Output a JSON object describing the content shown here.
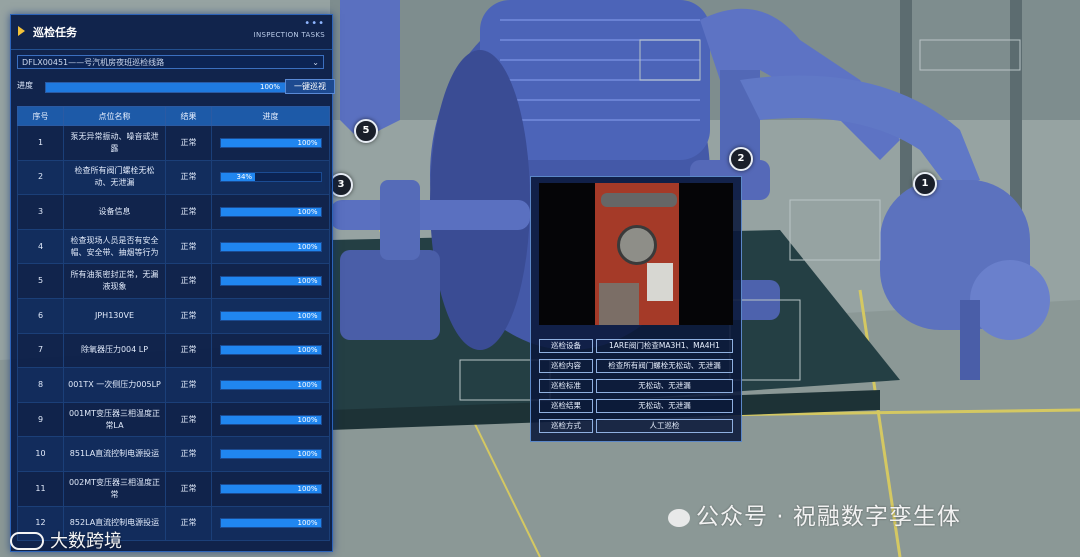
{
  "panel": {
    "title": "巡检任务",
    "subtitle": "INSPECTION TASKS",
    "dots": "•••",
    "route": "DFLX00451——号汽机房夜班巡检线路",
    "progress_label": "进度",
    "progress": 100,
    "progress_text": "100%",
    "oneclick_label": "一键巡视",
    "columns": [
      "序号",
      "点位名称",
      "结果",
      "进度"
    ],
    "rows": [
      {
        "no": "1",
        "name": "泵无异常振动、噪音或泄露",
        "result": "正常",
        "progress": 100,
        "pct": "100%"
      },
      {
        "no": "2",
        "name": "检查所有阀门螺栓无松动、无泄漏",
        "result": "正常",
        "progress": 34,
        "pct": "34%"
      },
      {
        "no": "3",
        "name": "设备信息",
        "result": "正常",
        "progress": 100,
        "pct": "100%"
      },
      {
        "no": "4",
        "name": "检查现场人员是否有安全帽、安全带、抽烟等行为",
        "result": "正常",
        "progress": 100,
        "pct": "100%"
      },
      {
        "no": "5",
        "name": "所有油泵密封正常，无漏液现象",
        "result": "正常",
        "progress": 100,
        "pct": "100%"
      },
      {
        "no": "6",
        "name": "JPH130VE",
        "result": "正常",
        "progress": 100,
        "pct": "100%"
      },
      {
        "no": "7",
        "name": "除氧器压力004 LP",
        "result": "正常",
        "progress": 100,
        "pct": "100%"
      },
      {
        "no": "8",
        "name": "001TX 一次侧压力005LP",
        "result": "正常",
        "progress": 100,
        "pct": "100%"
      },
      {
        "no": "9",
        "name": "001MT变压器三相温度正常LA",
        "result": "正常",
        "progress": 100,
        "pct": "100%"
      },
      {
        "no": "10",
        "name": "851LA直流控制电源投运",
        "result": "正常",
        "progress": 100,
        "pct": "100%"
      },
      {
        "no": "11",
        "name": "002MT变压器三相温度正常",
        "result": "正常",
        "progress": 100,
        "pct": "100%"
      },
      {
        "no": "12",
        "name": "852LA直流控制电源投运",
        "result": "正常",
        "progress": 100,
        "pct": "100%"
      }
    ]
  },
  "markers": [
    "1",
    "2",
    "3",
    "5"
  ],
  "popup": {
    "rows": [
      {
        "label": "巡检设备",
        "value": "1ARE阀门检查MA3H1、MA4H1"
      },
      {
        "label": "巡检内容",
        "value": "检查所有阀门螺栓无松动、无泄漏"
      },
      {
        "label": "巡检标准",
        "value": "无松动、无泄漏"
      },
      {
        "label": "巡检结果",
        "value": "无松动、无泄漏"
      },
      {
        "label": "巡检方式",
        "value": "人工巡检"
      }
    ]
  },
  "watermarks": {
    "right": "公众号 · 祝融数字孪生体",
    "left": "大数跨境"
  },
  "colors": {
    "panel_bg": "#081c46",
    "accent": "#1f7ae0",
    "header_blue": "#1d5aa8",
    "title_arrow": "#f3c23a"
  }
}
